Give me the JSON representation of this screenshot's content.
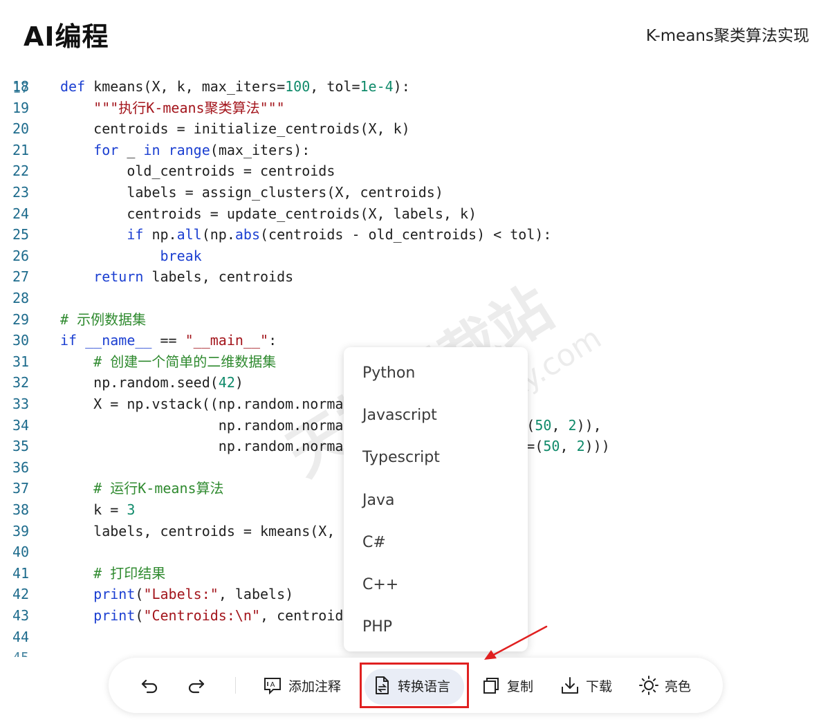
{
  "header": {
    "app_title": "AI编程",
    "doc_title": "K-means聚类算法实现"
  },
  "code": {
    "partial_top_line": "17",
    "partial_bottom_line": "45",
    "lines": [
      {
        "n": "18",
        "segments": [
          [
            "kw",
            "def"
          ],
          [
            "t",
            " kmeans"
          ],
          [
            "t",
            "(X, k, max_iters="
          ],
          [
            "num",
            "100"
          ],
          [
            "t",
            ", tol="
          ],
          [
            "num",
            "1e-4"
          ],
          [
            "t",
            "):"
          ]
        ]
      },
      {
        "n": "19",
        "segments": [
          [
            "t",
            "    "
          ],
          [
            "str",
            "\"\"\"执行K-means聚类算法\"\"\""
          ]
        ]
      },
      {
        "n": "20",
        "segments": [
          [
            "t",
            "    centroids = initialize_centroids(X, k)"
          ]
        ]
      },
      {
        "n": "21",
        "segments": [
          [
            "t",
            "    "
          ],
          [
            "kw",
            "for"
          ],
          [
            "t",
            " _ "
          ],
          [
            "kw",
            "in"
          ],
          [
            "t",
            " "
          ],
          [
            "fn",
            "range"
          ],
          [
            "t",
            "(max_iters):"
          ]
        ]
      },
      {
        "n": "22",
        "segments": [
          [
            "t",
            "        old_centroids = centroids"
          ]
        ]
      },
      {
        "n": "23",
        "segments": [
          [
            "t",
            "        labels = assign_clusters(X, centroids)"
          ]
        ]
      },
      {
        "n": "24",
        "segments": [
          [
            "t",
            "        centroids = update_centroids(X, labels, k)"
          ]
        ]
      },
      {
        "n": "25",
        "segments": [
          [
            "t",
            "        "
          ],
          [
            "kw",
            "if"
          ],
          [
            "t",
            " np."
          ],
          [
            "fn",
            "all"
          ],
          [
            "t",
            "(np."
          ],
          [
            "fn",
            "abs"
          ],
          [
            "t",
            "(centroids - old_centroids) < tol):"
          ]
        ]
      },
      {
        "n": "26",
        "segments": [
          [
            "t",
            "            "
          ],
          [
            "kw",
            "break"
          ]
        ]
      },
      {
        "n": "27",
        "segments": [
          [
            "t",
            "    "
          ],
          [
            "kw",
            "return"
          ],
          [
            "t",
            " labels, centroids"
          ]
        ]
      },
      {
        "n": "28",
        "segments": []
      },
      {
        "n": "29",
        "segments": [
          [
            "cm",
            "# 示例数据集"
          ]
        ]
      },
      {
        "n": "30",
        "segments": [
          [
            "kw",
            "if"
          ],
          [
            "t",
            " "
          ],
          [
            "pr",
            "__name__"
          ],
          [
            "t",
            " == "
          ],
          [
            "str",
            "\"__main__\""
          ],
          [
            "t",
            ":"
          ]
        ]
      },
      {
        "n": "31",
        "segments": [
          [
            "t",
            "    "
          ],
          [
            "cm",
            "# 创建一个简单的二维数据集"
          ]
        ]
      },
      {
        "n": "32",
        "segments": [
          [
            "t",
            "    np.random.seed("
          ],
          [
            "num",
            "42"
          ],
          [
            "t",
            ")"
          ]
        ]
      },
      {
        "n": "33",
        "segments": [
          [
            "t",
            "    X = np.vstack((np.random.norma"
          ]
        ]
      },
      {
        "n": "34",
        "segments": [
          [
            "t",
            "                   np.random.norma"
          ],
          [
            "t",
            "                   ze=("
          ],
          [
            "num",
            "50"
          ],
          [
            "t",
            ", "
          ],
          [
            "num",
            "2"
          ],
          [
            "t",
            ")),"
          ]
        ]
      },
      {
        "n": "35",
        "segments": [
          [
            "t",
            "                   np.random.norma"
          ],
          [
            "t",
            "                   ize=("
          ],
          [
            "num",
            "50"
          ],
          [
            "t",
            ", "
          ],
          [
            "num",
            "2"
          ],
          [
            "t",
            ")))"
          ]
        ]
      },
      {
        "n": "36",
        "segments": []
      },
      {
        "n": "37",
        "segments": [
          [
            "t",
            "    "
          ],
          [
            "cm",
            "# 运行K-means算法"
          ]
        ]
      },
      {
        "n": "38",
        "segments": [
          [
            "t",
            "    k = "
          ],
          [
            "num",
            "3"
          ]
        ]
      },
      {
        "n": "39",
        "segments": [
          [
            "t",
            "    labels, centroids = kmeans(X,"
          ]
        ]
      },
      {
        "n": "40",
        "segments": []
      },
      {
        "n": "41",
        "segments": [
          [
            "t",
            "    "
          ],
          [
            "cm",
            "# 打印结果"
          ]
        ]
      },
      {
        "n": "42",
        "segments": [
          [
            "t",
            "    "
          ],
          [
            "fn",
            "print"
          ],
          [
            "t",
            "("
          ],
          [
            "str",
            "\"Labels:\""
          ],
          [
            "t",
            ", labels)"
          ]
        ]
      },
      {
        "n": "43",
        "segments": [
          [
            "t",
            "    "
          ],
          [
            "fn",
            "print"
          ],
          [
            "t",
            "("
          ],
          [
            "str",
            "\"Centroids:\\n\""
          ],
          [
            "t",
            ", centroid"
          ]
        ]
      },
      {
        "n": "44",
        "segments": []
      }
    ]
  },
  "language_menu": {
    "items": [
      "Python",
      "Javascript",
      "Typescript",
      "Java",
      "C#",
      "C++",
      "PHP"
    ]
  },
  "toolbar": {
    "undo_icon": "undo-icon",
    "redo_icon": "redo-icon",
    "add_comment_label": "添加注释",
    "convert_language_label": "转换语言",
    "copy_label": "复制",
    "download_label": "下载",
    "light_mode_label": "亮色"
  },
  "annotation_color": "#e02020"
}
